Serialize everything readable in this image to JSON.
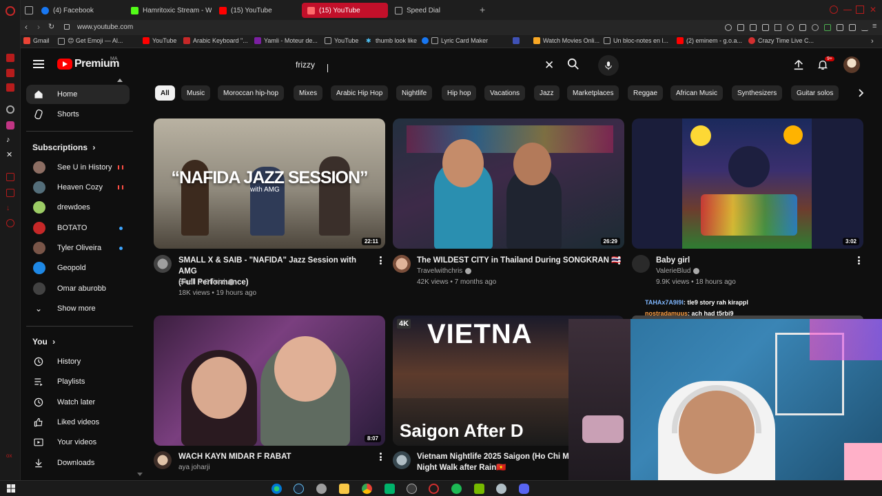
{
  "browser": {
    "tabs": [
      {
        "label": "(4) Facebook",
        "color": "#1877f2"
      },
      {
        "label": "Hamritoxic Stream - Watc",
        "color": "#53fc18"
      },
      {
        "label": "(15) YouTube",
        "color": "#ff0000"
      },
      {
        "label": "(15) YouTube",
        "color": "#ff0000",
        "active": true
      },
      {
        "label": "Speed Dial",
        "color": "#888888"
      }
    ],
    "url": "www.youtube.com",
    "bookmarks": [
      "Gmail",
      "😊 Get Emoji — Al...",
      "YouTube",
      "Arabic Keyboard \"...",
      "Yamli - Moteur de...",
      "YouTube",
      "thumb look like",
      "Lyric Card Maker",
      "Watch Movies Onli...",
      "Un bloc-notes en l...",
      "(2) eminem - g.o.a...",
      "Crazy Time Live C..."
    ]
  },
  "header": {
    "logo_text": "Premium",
    "country": "MA",
    "search_value": "frizzy",
    "notification_badge": "9+"
  },
  "nav": {
    "home": "Home",
    "shorts": "Shorts",
    "subscriptions_title": "Subscriptions",
    "subscriptions": [
      {
        "name": "See U in History ...",
        "indicator": "live"
      },
      {
        "name": "Heaven Cozy",
        "indicator": "live"
      },
      {
        "name": "drewdoes",
        "indicator": "none"
      },
      {
        "name": "BOTATO",
        "indicator": "new"
      },
      {
        "name": "Tyler Oliveira",
        "indicator": "new"
      },
      {
        "name": "Geopold",
        "indicator": "none"
      },
      {
        "name": "Omar aburobb",
        "indicator": "none"
      }
    ],
    "show_more": "Show more",
    "you_title": "You",
    "you_items": [
      "History",
      "Playlists",
      "Watch later",
      "Liked videos",
      "Your videos",
      "Downloads"
    ]
  },
  "chips": [
    "All",
    "Music",
    "Moroccan hip-hop",
    "Mixes",
    "Arabic Hip Hop",
    "Nightlife",
    "Hip hop",
    "Vacations",
    "Jazz",
    "Marketplaces",
    "Reggae",
    "African Music",
    "Synthesizers",
    "Guitar solos"
  ],
  "videos": [
    {
      "title_line1": "SMALL X & SAIB - \"NAFIDA\" Jazz Session with AMG",
      "title_line2": "(Full Performance)",
      "channel": "Small X Official",
      "meta": "18K views • 19 hours ago",
      "duration": "22:11",
      "thumb_text": "“NAFIDA JAZZ SESSION”",
      "thumb_sub": "with AMG"
    },
    {
      "title_line1": "The WILDEST CITY in Thailand During SONGKRAN 🇹🇭",
      "title_line2": "",
      "channel": "Travelwithchris",
      "meta": "42K views • 7 months ago",
      "duration": "26:29"
    },
    {
      "title_line1": "Baby girl",
      "title_line2": "",
      "channel": "ValerieBlud",
      "meta": "9.9K views • 18 hours ago",
      "duration": "3:02"
    },
    {
      "title_line1": "WACH KAYN MIDAR F RABAT",
      "title_line2": "",
      "channel": "aya joharji",
      "meta": "",
      "duration": "8:07"
    },
    {
      "title_line1": "Vietnam Nightlife 2025 Saigon (Ho Chi Mi",
      "title_line2": "Night Walk after Rain🇻🇳",
      "channel": "",
      "meta": "",
      "duration": "",
      "thumb_text": "VIETNA",
      "thumb_sub": "Saigon After D",
      "badge": "4K"
    }
  ],
  "stream_chat": [
    {
      "user": "TAHAx7A9l9l",
      "msg": ": tle9 story rah kirappl"
    },
    {
      "user": "nostradamuus",
      "msg": ": ach had t5rbi9"
    }
  ]
}
